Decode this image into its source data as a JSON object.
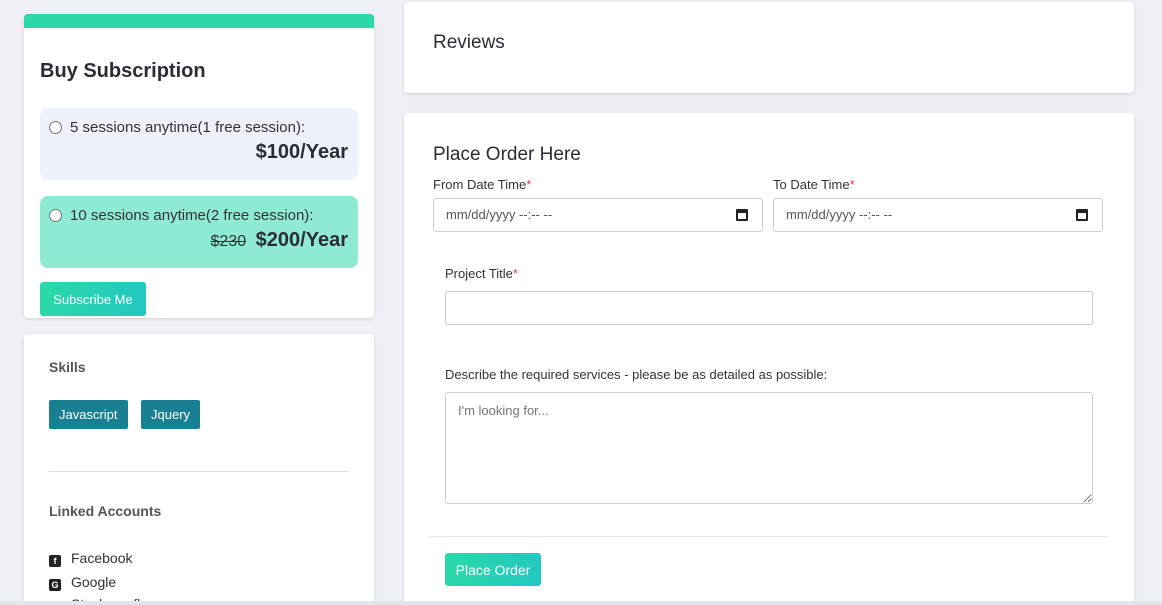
{
  "subscription": {
    "title": "Buy Subscription",
    "accent_color": "#2bd9a8",
    "plans": [
      {
        "label": "5 sessions anytime(1 free session):",
        "old_price": "",
        "price": "$100/Year"
      },
      {
        "label": "10 sessions anytime(2 free session):",
        "old_price": "$230",
        "price": "$200/Year"
      }
    ],
    "subscribe_label": "Subscribe Me"
  },
  "skills": {
    "title": "Skills",
    "tags": [
      "Javascript",
      "Jquery"
    ],
    "tag_color": "#197f92"
  },
  "linked": {
    "title": "Linked Accounts",
    "accounts": [
      {
        "name": "Facebook",
        "icon": "facebook-icon"
      },
      {
        "name": "Google",
        "icon": "google-plus-icon"
      },
      {
        "name": "Stackoverflow",
        "icon": "stackoverflow-icon"
      }
    ]
  },
  "reviews": {
    "title": "Reviews"
  },
  "order": {
    "title": "Place Order Here",
    "from_label": "From Date Time",
    "to_label": "To Date Time",
    "date_placeholder": "mm/dd/yyyy --:-- --",
    "project_title_label": "Project Title",
    "describe_label": "Describe the required services - please be as detailed as possible:",
    "describe_placeholder": "I'm looking for...",
    "submit_label": "Place Order",
    "required_mark": "*"
  }
}
